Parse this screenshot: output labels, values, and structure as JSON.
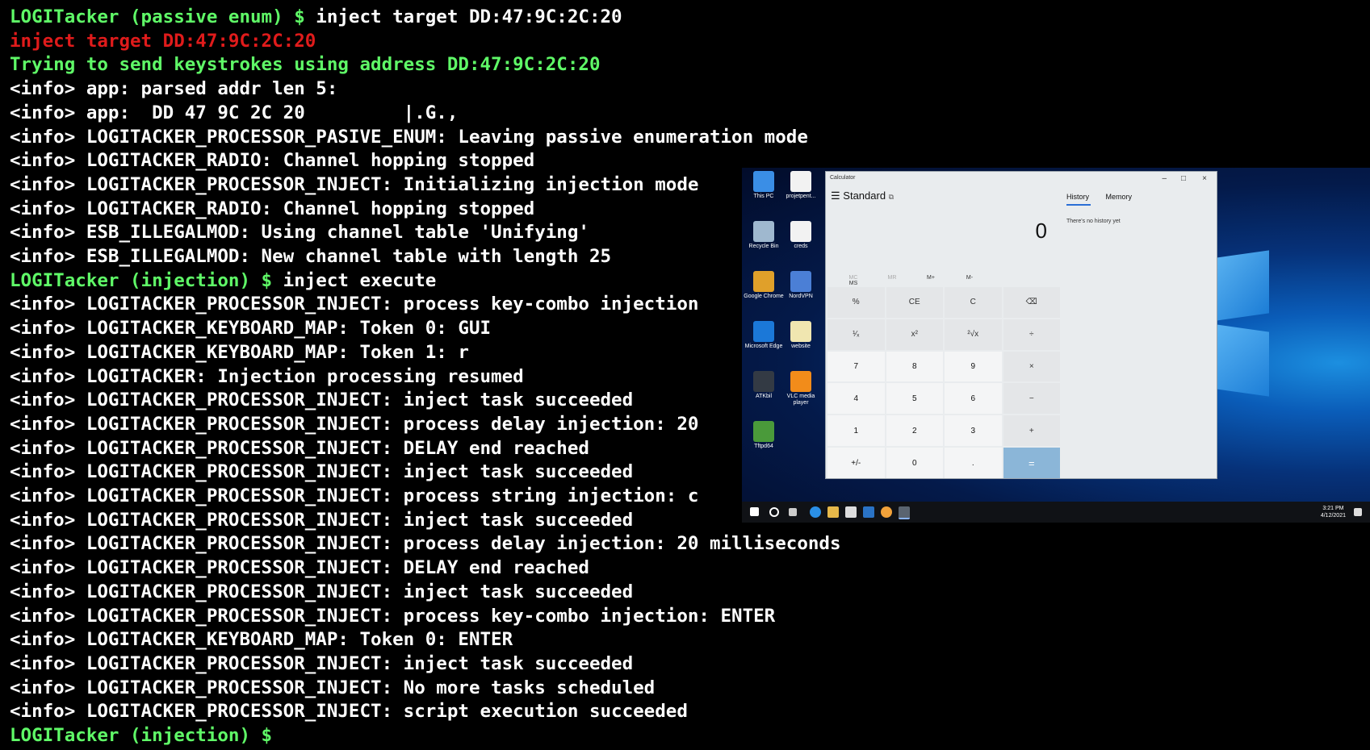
{
  "terminal": {
    "lines": [
      {
        "prompt": "LOGITacker (passive enum) $ ",
        "cmd": "inject target DD:47:9C:2C:20"
      },
      {
        "red": "inject target DD:47:9C:2C:20"
      },
      {
        "green": "Trying to send keystrokes using address DD:47:9C:2C:20"
      },
      {
        "text": "<info> app: parsed addr len 5:"
      },
      {
        "text": "<info> app:  DD 47 9C 2C 20         |.G.,"
      },
      {
        "text": "<info> LOGITACKER_PROCESSOR_PASIVE_ENUM: Leaving passive enumeration mode"
      },
      {
        "text": "<info> LOGITACKER_RADIO: Channel hopping stopped"
      },
      {
        "text": "<info> LOGITACKER_PROCESSOR_INJECT: Initializing injection mode"
      },
      {
        "text": "<info> LOGITACKER_RADIO: Channel hopping stopped"
      },
      {
        "text": "<info> ESB_ILLEGALMOD: Using channel table 'Unifying'"
      },
      {
        "text": "<info> ESB_ILLEGALMOD: New channel table with length 25"
      },
      {
        "prompt": "LOGITacker (injection) $ ",
        "cmd": "inject execute"
      },
      {
        "text": "<info> LOGITACKER_PROCESSOR_INJECT: process key-combo injection"
      },
      {
        "text": "<info> LOGITACKER_KEYBOARD_MAP: Token 0: GUI"
      },
      {
        "text": "<info> LOGITACKER_KEYBOARD_MAP: Token 1: r"
      },
      {
        "text": "<info> LOGITACKER: Injection processing resumed"
      },
      {
        "text": "<info> LOGITACKER_PROCESSOR_INJECT: inject task succeeded"
      },
      {
        "text": "<info> LOGITACKER_PROCESSOR_INJECT: process delay injection: 20"
      },
      {
        "text": "<info> LOGITACKER_PROCESSOR_INJECT: DELAY end reached"
      },
      {
        "text": "<info> LOGITACKER_PROCESSOR_INJECT: inject task succeeded"
      },
      {
        "text": "<info> LOGITACKER_PROCESSOR_INJECT: process string injection: c"
      },
      {
        "text": "<info> LOGITACKER_PROCESSOR_INJECT: inject task succeeded"
      },
      {
        "text": "<info> LOGITACKER_PROCESSOR_INJECT: process delay injection: 20 milliseconds"
      },
      {
        "text": "<info> LOGITACKER_PROCESSOR_INJECT: DELAY end reached"
      },
      {
        "text": "<info> LOGITACKER_PROCESSOR_INJECT: inject task succeeded"
      },
      {
        "text": "<info> LOGITACKER_PROCESSOR_INJECT: process key-combo injection: ENTER"
      },
      {
        "text": "<info> LOGITACKER_KEYBOARD_MAP: Token 0: ENTER"
      },
      {
        "text": "<info> LOGITACKER_PROCESSOR_INJECT: inject task succeeded"
      },
      {
        "text": "<info> LOGITACKER_PROCESSOR_INJECT: No more tasks scheduled"
      },
      {
        "text": "<info> LOGITACKER_PROCESSOR_INJECT: script execution succeeded"
      },
      {
        "prompt": "LOGITacker (injection) $ ",
        "cmd": ""
      }
    ]
  },
  "desktop": {
    "icons": [
      {
        "label": "This PC",
        "name": "this-pc-icon",
        "color": "#3a8ee6"
      },
      {
        "label": "projetpent...",
        "name": "document-icon",
        "color": "#f2f2f2"
      },
      {
        "label": "Recycle Bin",
        "name": "recycle-bin-icon",
        "color": "#9fb8cf"
      },
      {
        "label": "creds",
        "name": "document-icon",
        "color": "#f2f2f2"
      },
      {
        "label": "Google Chrome",
        "name": "chrome-icon",
        "color": "#e0a02a"
      },
      {
        "label": "NordVPN",
        "name": "nordvpn-icon",
        "color": "#4b7fd6"
      },
      {
        "label": "Microsoft Edge",
        "name": "edge-icon",
        "color": "#1b78d8"
      },
      {
        "label": "website",
        "name": "document-icon",
        "color": "#f0e6b0"
      },
      {
        "label": "ATKbil",
        "name": "app-icon",
        "color": "#333a44"
      },
      {
        "label": "VLC media player",
        "name": "vlc-icon",
        "color": "#f28c1a"
      },
      {
        "label": "Tftpd64",
        "name": "tftpd-icon",
        "color": "#4a9a3a"
      }
    ],
    "tray": {
      "time": "3:21 PM",
      "date": "4/12/2021"
    }
  },
  "calculator": {
    "title": "Calculator",
    "mode": "Standard",
    "display": "0",
    "memory_row": [
      "MC",
      "MR",
      "M+",
      "M-",
      "MS"
    ],
    "keys": [
      "%",
      "CE",
      "C",
      "⌫",
      "¹⁄ₓ",
      "x²",
      "²√x",
      "÷",
      "7",
      "8",
      "9",
      "×",
      "4",
      "5",
      "6",
      "−",
      "1",
      "2",
      "3",
      "+",
      "+/-",
      "0",
      ".",
      "="
    ],
    "tabs": [
      "History",
      "Memory"
    ],
    "history_empty": "There's no history yet"
  }
}
